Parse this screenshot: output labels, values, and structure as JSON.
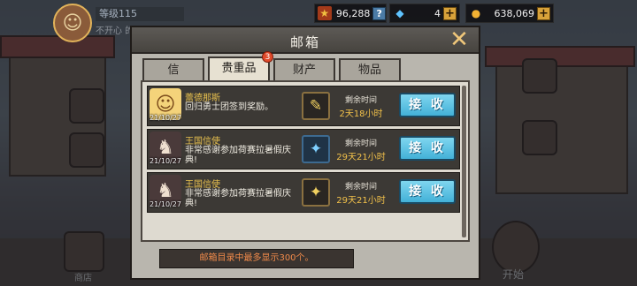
{
  "player": {
    "level_text": "等级115",
    "status_text": "不开心 的"
  },
  "currency": {
    "gold_count": "96,288",
    "gem_count": "4",
    "coin_count": "638,069"
  },
  "bottom_left": {
    "shop_label": "商店"
  },
  "bottom_right": {
    "start_label": "开始"
  },
  "dialog": {
    "title": "邮箱",
    "close_icon": "close-icon",
    "tabs": [
      {
        "label": "信",
        "active": false
      },
      {
        "label": "贵重品",
        "active": true,
        "badge": "3"
      },
      {
        "label": "财产",
        "active": false
      },
      {
        "label": "物品",
        "active": false
      }
    ],
    "mails": [
      {
        "sender": "蕾德那斯",
        "message": "回归勇士团签到奖励。",
        "date": "21/10/27",
        "avatar_icon": "blonde-character-icon",
        "reward_icon": "gold-ticket-icon",
        "time_label": "剩余时间",
        "time_value": "2天18小时",
        "button_label": "接 收"
      },
      {
        "sender": "王国信使",
        "message": "非常感谢参加荷赛拉暑假庆典!",
        "date": "21/10/27",
        "avatar_icon": "messenger-character-icon",
        "reward_icon": "blue-ticket-icon",
        "time_label": "剩余时间",
        "time_value": "29天21小时",
        "button_label": "接 收"
      },
      {
        "sender": "王国信使",
        "message": "非常感谢参加荷赛拉暑假庆典!",
        "date": "21/10/27",
        "avatar_icon": "messenger-character-icon",
        "reward_icon": "gold-ticket-icon",
        "time_label": "剩余时间",
        "time_value": "29天21小时",
        "button_label": "接 收"
      }
    ],
    "footer_note": "邮箱目录中最多显示300个。"
  },
  "colors": {
    "accent_gold": "#e9c14e",
    "button_blue": "#43b1d8",
    "badge_red": "#e04a2a"
  }
}
